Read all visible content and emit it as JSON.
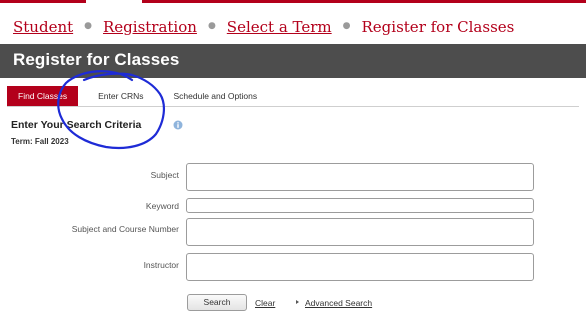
{
  "breadcrumb": {
    "items": [
      "Student",
      "Registration",
      "Select a Term"
    ],
    "current": "Register for Classes"
  },
  "header": {
    "title": "Register for Classes"
  },
  "tabs": {
    "find_classes": "Find Classes",
    "enter_crns": "Enter CRNs",
    "schedule_options": "Schedule and Options",
    "active": "Find Classes"
  },
  "search_criteria": {
    "title": "Enter Your Search Criteria",
    "term": "Term: Fall 2023"
  },
  "form": {
    "subject_label": "Subject",
    "subject_value": "",
    "keyword_label": "Keyword",
    "keyword_value": "",
    "course_number_label": "Subject and Course Number",
    "course_number_value": "",
    "instructor_label": "Instructor",
    "instructor_value": ""
  },
  "actions": {
    "search": "Search",
    "clear": "Clear",
    "advanced_search": "Advanced Search"
  },
  "icons": {
    "info": "info-icon",
    "advanced_arrow": "triangle-right-icon"
  },
  "colors": {
    "brand": "#b3001b",
    "header_bg": "#4d4d4d",
    "annotation_pen": "#1e2bd6"
  }
}
